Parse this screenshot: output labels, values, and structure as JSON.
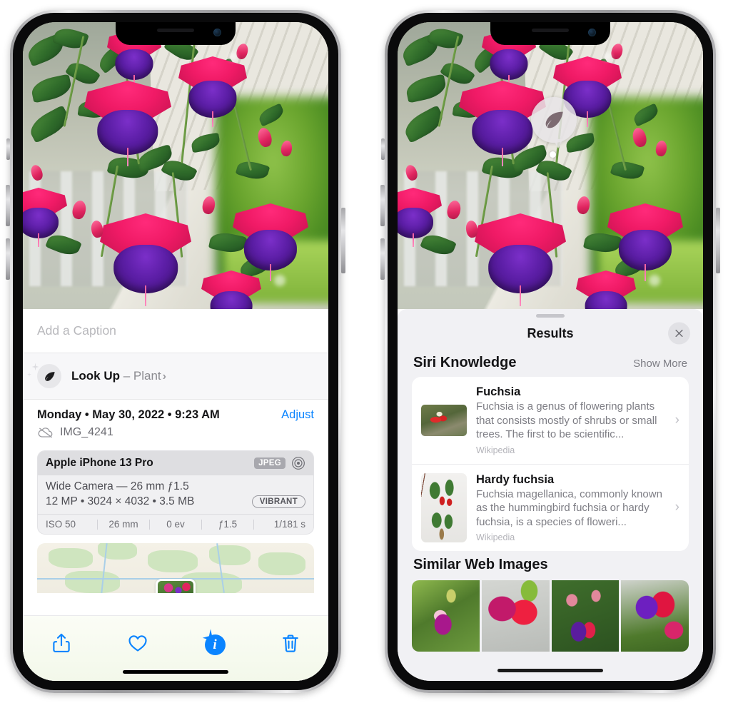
{
  "left_phone": {
    "caption_placeholder": "Add a Caption",
    "lookup": {
      "label": "Look Up",
      "separator": " – ",
      "subject": "Plant",
      "chevron": "›",
      "icon": "leaf-icon"
    },
    "metadata": {
      "date_line": "Monday • May 30, 2022 • 9:23 AM",
      "adjust_label": "Adjust",
      "filename": "IMG_4241",
      "cloud_icon": "icloud-slash-icon"
    },
    "exif": {
      "device": "Apple iPhone 13 Pro",
      "format_tag": "JPEG",
      "raw_icon": "target-icon",
      "lens": "Wide Camera — 26 mm ƒ1.5",
      "specs": "12 MP • 3024 × 4032 • 3.5 MB",
      "style_tag": "VIBRANT",
      "shot_values": [
        "ISO 50",
        "26 mm",
        "0 ev",
        "ƒ1.5",
        "1/181 s"
      ]
    },
    "toolbar": {
      "share_label": "share-icon",
      "favorite_label": "heart-icon",
      "info_label": "info-sparkle-icon",
      "delete_label": "trash-icon",
      "accent_color": "#0a84ff"
    }
  },
  "right_phone": {
    "photo_badge": {
      "icon": "leaf-icon"
    },
    "sheet": {
      "title": "Results",
      "close_label": "close-icon"
    },
    "siri_knowledge": {
      "section_title": "Siri Knowledge",
      "show_more": "Show More",
      "items": [
        {
          "title": "Fuchsia",
          "description": "Fuchsia is a genus of flowering plants that consists mostly of shrubs or small trees. The first to be scientific...",
          "source": "Wikipedia",
          "thumb_orientation": "landscape"
        },
        {
          "title": "Hardy fuchsia",
          "description": "Fuchsia magellanica, commonly known as the hummingbird fuchsia or hardy fuchsia, is a species of floweri...",
          "source": "Wikipedia",
          "thumb_orientation": "portrait"
        }
      ]
    },
    "similar_web_images": {
      "section_title": "Similar Web Images",
      "thumbnail_count": 4
    }
  }
}
